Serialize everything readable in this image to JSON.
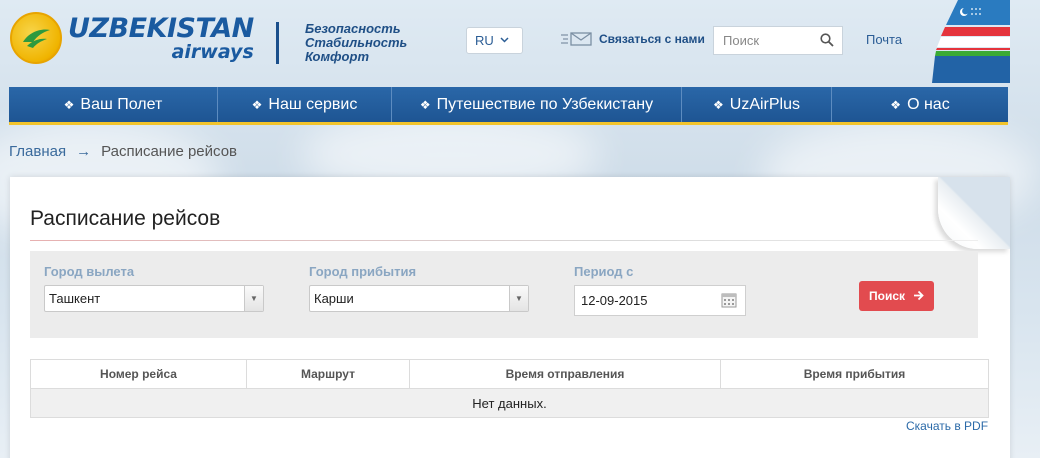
{
  "header": {
    "logo_main": "UZBEKISTAN",
    "logo_sub": "airways",
    "slogan": [
      "Безопасность",
      "Стабильность",
      "Комфорт"
    ],
    "language": "RU",
    "contact_label": "Связаться с нами",
    "search_placeholder": "Поиск",
    "mail_label": "Почта"
  },
  "nav": {
    "items": [
      {
        "label": "Ваш Полет"
      },
      {
        "label": "Наш сервис"
      },
      {
        "label": "Путешествие по Узбекистану"
      },
      {
        "label": "UzAirPlus"
      },
      {
        "label": "О нас"
      }
    ]
  },
  "breadcrumb": {
    "home": "Главная",
    "arrow": "→",
    "current": "Расписание рейсов"
  },
  "page": {
    "title": "Расписание рейсов"
  },
  "filters": {
    "departure_label": "Город вылета",
    "departure_value": "Ташкент",
    "arrival_label": "Город прибытия",
    "arrival_value": "Карши",
    "period_label": "Период с",
    "period_value": "12-09-2015",
    "search_button": "Поиск"
  },
  "table": {
    "headers": [
      "Номер рейса",
      "Маршрут",
      "Время отправления",
      "Время прибытия"
    ],
    "empty_message": "Нет данных."
  },
  "download_pdf": "Скачать в PDF",
  "colors": {
    "brand_blue": "#1e5593",
    "accent_yellow": "#f2c42c",
    "search_button": "#e24b4f"
  }
}
